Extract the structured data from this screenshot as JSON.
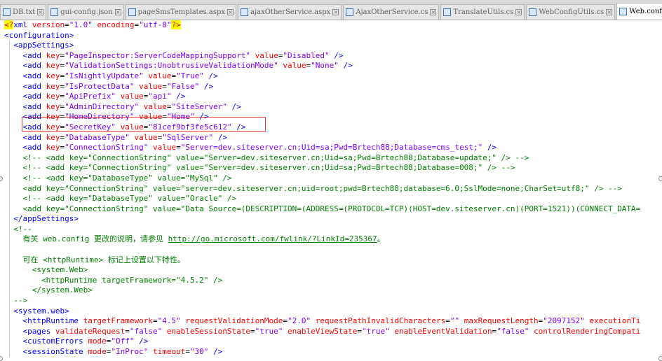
{
  "tabs": [
    {
      "label": "DB.txt",
      "active": false
    },
    {
      "label": "gui-config.json",
      "active": false
    },
    {
      "label": "pageSmsTemplates.aspx",
      "active": false
    },
    {
      "label": "ajaxOtherService.aspx",
      "active": false
    },
    {
      "label": "AjaxOtherService.cs",
      "active": false
    },
    {
      "label": "TranslateUtils.cs",
      "active": false
    },
    {
      "label": "WebConfigUtils.cs",
      "active": false
    },
    {
      "label": "Web.config",
      "active": true
    },
    {
      "label": "",
      "active": false
    }
  ],
  "lines": [
    [
      [
        "pi",
        "<?"
      ],
      [
        "t",
        "xml "
      ],
      [
        "a",
        "version"
      ],
      [
        "p",
        "="
      ],
      [
        "v",
        "\"1.0\""
      ],
      [
        "p",
        " "
      ],
      [
        "a",
        "encoding"
      ],
      [
        "p",
        "="
      ],
      [
        "v",
        "\"utf-8\""
      ],
      [
        "pi",
        "?>"
      ]
    ],
    [
      [
        "t",
        "<configuration>"
      ]
    ],
    [
      [
        "p",
        "  "
      ],
      [
        "t",
        "<appSettings>"
      ]
    ],
    [
      [
        "p",
        "    "
      ],
      [
        "t",
        "<add "
      ],
      [
        "a",
        "key"
      ],
      [
        "p",
        "="
      ],
      [
        "v",
        "\"PageInspector:ServerCodeMappingSupport\""
      ],
      [
        "p",
        " "
      ],
      [
        "a",
        "value"
      ],
      [
        "p",
        "="
      ],
      [
        "v",
        "\"Disabled\""
      ],
      [
        "p",
        " "
      ],
      [
        "t",
        "/>"
      ]
    ],
    [
      [
        "p",
        "    "
      ],
      [
        "t",
        "<add "
      ],
      [
        "a",
        "key"
      ],
      [
        "p",
        "="
      ],
      [
        "v",
        "\"ValidationSettings:UnobtrusiveValidationMode\""
      ],
      [
        "p",
        " "
      ],
      [
        "a",
        "value"
      ],
      [
        "p",
        "="
      ],
      [
        "v",
        "\"None\""
      ],
      [
        "p",
        " "
      ],
      [
        "t",
        "/>"
      ]
    ],
    [
      [
        "p",
        "    "
      ],
      [
        "t",
        "<add "
      ],
      [
        "a",
        "key"
      ],
      [
        "p",
        "="
      ],
      [
        "v",
        "\"IsNightlyUpdate\""
      ],
      [
        "p",
        " "
      ],
      [
        "a",
        "value"
      ],
      [
        "p",
        "="
      ],
      [
        "v",
        "\"True\""
      ],
      [
        "p",
        " "
      ],
      [
        "t",
        "/>"
      ]
    ],
    [
      [
        "p",
        "    "
      ],
      [
        "t",
        "<add "
      ],
      [
        "a",
        "key"
      ],
      [
        "p",
        "="
      ],
      [
        "v",
        "\"IsProtectData\""
      ],
      [
        "p",
        " "
      ],
      [
        "a",
        "value"
      ],
      [
        "p",
        "="
      ],
      [
        "v",
        "\"False\""
      ],
      [
        "p",
        " "
      ],
      [
        "t",
        "/>"
      ]
    ],
    [
      [
        "p",
        "    "
      ],
      [
        "t",
        "<add "
      ],
      [
        "a",
        "key"
      ],
      [
        "p",
        "="
      ],
      [
        "v",
        "\"ApiPrefix\""
      ],
      [
        "p",
        " "
      ],
      [
        "a",
        "value"
      ],
      [
        "p",
        "="
      ],
      [
        "v",
        "\"api\""
      ],
      [
        "p",
        " "
      ],
      [
        "t",
        "/>"
      ]
    ],
    [
      [
        "p",
        "    "
      ],
      [
        "t",
        "<add "
      ],
      [
        "a",
        "key"
      ],
      [
        "p",
        "="
      ],
      [
        "v",
        "\"AdminDirectory\""
      ],
      [
        "p",
        " "
      ],
      [
        "a",
        "value"
      ],
      [
        "p",
        "="
      ],
      [
        "v",
        "\"SiteServer\""
      ],
      [
        "p",
        " "
      ],
      [
        "t",
        "/>"
      ]
    ],
    [
      [
        "p",
        "    "
      ],
      [
        "t",
        "<add "
      ],
      [
        "a",
        "key"
      ],
      [
        "p",
        "="
      ],
      [
        "v",
        "\"HomeDirectory\""
      ],
      [
        "p",
        " "
      ],
      [
        "a",
        "value"
      ],
      [
        "p",
        "="
      ],
      [
        "v",
        "\"Home\""
      ],
      [
        "p",
        " "
      ],
      [
        "t",
        "/>"
      ]
    ],
    [
      [
        "p",
        "    "
      ],
      [
        "t",
        "<add "
      ],
      [
        "a",
        "key"
      ],
      [
        "p",
        "="
      ],
      [
        "v",
        "\"SecretKey\""
      ],
      [
        "p",
        " "
      ],
      [
        "a",
        "value"
      ],
      [
        "p",
        "="
      ],
      [
        "v",
        "\"81cef9bf3fe5c612\""
      ],
      [
        "p",
        " "
      ],
      [
        "t",
        "/>"
      ]
    ],
    [
      [
        "p",
        "    "
      ],
      [
        "t",
        "<add "
      ],
      [
        "a",
        "key"
      ],
      [
        "p",
        "="
      ],
      [
        "v",
        "\"DatabaseType\""
      ],
      [
        "p",
        " "
      ],
      [
        "a",
        "value"
      ],
      [
        "p",
        "="
      ],
      [
        "v",
        "\"SqlServer\""
      ],
      [
        "p",
        " "
      ],
      [
        "t",
        "/>"
      ]
    ],
    [
      [
        "p",
        "    "
      ],
      [
        "t",
        "<add "
      ],
      [
        "a",
        "key"
      ],
      [
        "p",
        "="
      ],
      [
        "v",
        "\"ConnectionString\""
      ],
      [
        "p",
        " "
      ],
      [
        "a",
        "value"
      ],
      [
        "p",
        "="
      ],
      [
        "v",
        "\"Server=dev.siteserver.cn;Uid=sa;Pwd=Brtech88;Database=cms_test;\""
      ],
      [
        "p",
        " "
      ],
      [
        "t",
        "/>"
      ]
    ],
    [
      [
        "p",
        "    "
      ],
      [
        "c",
        "<!-- <add key=\"ConnectionString\" value=\"Server=dev.siteserver.cn;Uid=sa;Pwd=Brtech88;Database=update;\" /> -->"
      ]
    ],
    [
      [
        "p",
        "    "
      ],
      [
        "c",
        "<!-- <add key=\"ConnectionString\" value=\"Server=dev.siteserver.cn;Uid=sa;Pwd=Brtech88;Database=008;\" /> -->"
      ]
    ],
    [
      [
        "p",
        "    "
      ],
      [
        "c",
        "<!-- <add key=\"DatabaseType\" value=\"MySql\" />"
      ]
    ],
    [
      [
        "p",
        "    "
      ],
      [
        "c",
        "<add key=\"ConnectionString\" value=\"server=dev.siteserver.cn;uid=root;pwd=Brtech88;database=6.0;SslMode=none;CharSet=utf8;\" /> -->"
      ]
    ],
    [
      [
        "p",
        "    "
      ],
      [
        "c",
        "<!-- <add key=\"DatabaseType\" value=\"Oracle\" />"
      ]
    ],
    [
      [
        "p",
        "    "
      ],
      [
        "c",
        "<add key=\"ConnectionString\" value=\"Data Source=(DESCRIPTION=(ADDRESS=(PROTOCOL=TCP)(HOST=dev.siteserver.cn)(PORT=1521))(CONNECT_DATA="
      ]
    ],
    [
      [
        "p",
        "  "
      ],
      [
        "t",
        "</appSettings>"
      ]
    ],
    [
      [
        "p",
        "  "
      ],
      [
        "c",
        "<!--"
      ]
    ],
    [
      [
        "p",
        "    "
      ],
      [
        "c",
        "有关 web.config 更改的说明，请参见 "
      ],
      [
        "url",
        "http://go.microsoft.com/fwlink/?LinkId=235367"
      ],
      [
        "c",
        "。"
      ]
    ],
    [
      [
        "p",
        ""
      ]
    ],
    [
      [
        "p",
        "    "
      ],
      [
        "c",
        "可在 <httpRuntime> 标记上设置以下特性。"
      ]
    ],
    [
      [
        "p",
        "      "
      ],
      [
        "c",
        "<system.Web>"
      ]
    ],
    [
      [
        "p",
        "        "
      ],
      [
        "c",
        "<httpRuntime targetFramework=\"4.5.2\" />"
      ]
    ],
    [
      [
        "p",
        "      "
      ],
      [
        "c",
        "</system.Web>"
      ]
    ],
    [
      [
        "p",
        "  "
      ],
      [
        "c",
        "-->"
      ]
    ],
    [
      [
        "p",
        "  "
      ],
      [
        "t",
        "<system.web>"
      ]
    ],
    [
      [
        "p",
        "    "
      ],
      [
        "t",
        "<httpRuntime "
      ],
      [
        "a",
        "targetFramework"
      ],
      [
        "p",
        "="
      ],
      [
        "v",
        "\"4.5\""
      ],
      [
        "p",
        " "
      ],
      [
        "a",
        "requestValidationMode"
      ],
      [
        "p",
        "="
      ],
      [
        "v",
        "\"2.0\""
      ],
      [
        "p",
        " "
      ],
      [
        "a",
        "requestPathInvalidCharacters"
      ],
      [
        "p",
        "="
      ],
      [
        "v",
        "\"\""
      ],
      [
        "p",
        " "
      ],
      [
        "a",
        "maxRequestLength"
      ],
      [
        "p",
        "="
      ],
      [
        "v",
        "\"2097152\""
      ],
      [
        "p",
        " "
      ],
      [
        "a",
        "executionTi"
      ]
    ],
    [
      [
        "p",
        "    "
      ],
      [
        "t",
        "<pages "
      ],
      [
        "a",
        "validateRequest"
      ],
      [
        "p",
        "="
      ],
      [
        "v",
        "\"false\""
      ],
      [
        "p",
        " "
      ],
      [
        "a",
        "enableSessionState"
      ],
      [
        "p",
        "="
      ],
      [
        "v",
        "\"true\""
      ],
      [
        "p",
        " "
      ],
      [
        "a",
        "enableViewState"
      ],
      [
        "p",
        "="
      ],
      [
        "v",
        "\"true\""
      ],
      [
        "p",
        " "
      ],
      [
        "a",
        "enableEventValidation"
      ],
      [
        "p",
        "="
      ],
      [
        "v",
        "\"false\""
      ],
      [
        "p",
        " "
      ],
      [
        "a",
        "controlRenderingCompati"
      ]
    ],
    [
      [
        "p",
        "    "
      ],
      [
        "t",
        "<customErrors "
      ],
      [
        "a",
        "mode"
      ],
      [
        "p",
        "="
      ],
      [
        "v",
        "\"Off\""
      ],
      [
        "p",
        " "
      ],
      [
        "t",
        "/>"
      ]
    ],
    [
      [
        "p",
        "    "
      ],
      [
        "t",
        "<sessionState "
      ],
      [
        "a",
        "mode"
      ],
      [
        "p",
        "="
      ],
      [
        "v",
        "\"InProc\""
      ],
      [
        "p",
        " "
      ],
      [
        "a",
        "timeout"
      ],
      [
        "p",
        "="
      ],
      [
        "v",
        "\"30\""
      ],
      [
        "p",
        " "
      ],
      [
        "t",
        "/>"
      ]
    ]
  ]
}
